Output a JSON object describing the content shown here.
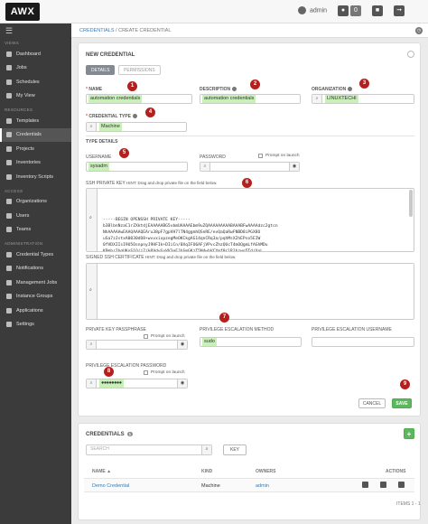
{
  "app": {
    "logo": "AWX"
  },
  "topbar": {
    "user": "admin",
    "notif_icon": "bell-icon",
    "badge_count": "0"
  },
  "sidebar": {
    "menu_icon": "☰",
    "sections": {
      "views": "VIEWS",
      "resources": "RESOURCES",
      "access": "ACCESS",
      "administration": "ADMINISTRATION"
    },
    "views": [
      "Dashboard",
      "Jobs",
      "Schedules",
      "My View"
    ],
    "resources": [
      "Templates",
      "Credentials",
      "Projects",
      "Inventories",
      "Inventory Scripts"
    ],
    "access": [
      "Organizations",
      "Users",
      "Teams"
    ],
    "administration": [
      "Credential Types",
      "Notifications",
      "Management Jobs",
      "Instance Groups",
      "Applications",
      "Settings"
    ]
  },
  "breadcrumb": {
    "link": "CREDENTIALS",
    "sep": " / ",
    "current": "CREATE CREDENTIAL"
  },
  "form": {
    "title": "NEW CREDENTIAL",
    "tabs": {
      "details": "DETAILS",
      "permissions": "PERMISSIONS"
    },
    "name": {
      "label": "NAME",
      "value": "automation credentials"
    },
    "description": {
      "label": "DESCRIPTION",
      "value": "automation credentials"
    },
    "organization": {
      "label": "ORGANIZATION",
      "value": "LINUXTECHI"
    },
    "credential_type": {
      "label": "CREDENTIAL TYPE",
      "value": "Machine"
    },
    "type_details": "TYPE DETAILS",
    "username": {
      "label": "USERNAME",
      "value": "sysadm"
    },
    "password": {
      "label": "PASSWORD",
      "prompt": "Prompt on launch"
    },
    "ssh_key": {
      "label": "SSH PRIVATE KEY",
      "hint": "HINT: Drag and drop private file on the field below.",
      "lines": [
        "-----BEGIN OPENSSH PRIVATE KEY-----",
        "b3BlbnNzaC1rZXktdjEAAAAABG5vbmUAAAAEbm9uZQAAAAAAAAABAAABFwAAAAdzc2gtcn",
        "NhAAAAAwEAAQAAAQEAru38pF7gpVH7lTN4ggmhQSnRE/evQaQaRwFNBD8iPGX8O",
        "uSa7zJstxA0030dO8+wvvxixpzegMeOKCkgAG14qnCRq3a/pqhMsX2hEPso5EIW",
        "0fVDXIIsI9U5OsnpnyJ9HFIk+DIiCn/0XqIFO6AFjVPvcZhzQUcT4mOQgmLfAGhMDu",
        "KPmbrIbgUKoS1Q/j7/k0VdvGyVV3eEJhSmGKzT5N4whVCYmf9rlR1bzwo5Td/XnL",
        "5yFlZdbZ3hIQaH3pRBi0WldSn2CEdQJDnmIzTbPHHd0E+p/mTmAFWhiD0mNRmzNvbH",
        "FFKBnuXkQfyg8SLoqqIs5rVCsJ0VNRVwwYFSe3tjRHK1mW2IEuRlFt9+UWLGTR4b"
      ]
    },
    "signed_cert": {
      "label": "SIGNED SSH CERTIFICATE",
      "hint": "HINT: Drag and drop private file on the field below."
    },
    "key_passphrase": {
      "label": "PRIVATE KEY PASSPHRASE",
      "prompt": "Prompt on launch"
    },
    "escalation_method": {
      "label": "PRIVILEGE ESCALATION METHOD",
      "value": "sudo"
    },
    "escalation_username": {
      "label": "PRIVILEGE ESCALATION USERNAME"
    },
    "escalation_password": {
      "label": "PRIVILEGE ESCALATION PASSWORD",
      "value": "●●●●●●●●",
      "prompt": "Prompt on launch"
    },
    "buttons": {
      "cancel": "CANCEL",
      "save": "SAVE"
    },
    "callouts": [
      "1",
      "2",
      "3",
      "4",
      "5",
      "6",
      "7",
      "8",
      "9"
    ]
  },
  "list": {
    "title": "CREDENTIALS",
    "count": "1",
    "search_placeholder": "SEARCH",
    "key_button": "KEY",
    "columns": {
      "name": "NAME ▲",
      "kind": "KIND",
      "owners": "OWNERS",
      "actions": "ACTIONS"
    },
    "rows": [
      {
        "name": "Demo Credential",
        "kind": "Machine",
        "owners": "admin"
      }
    ],
    "pager": "ITEMS 1 - 1"
  },
  "colors": {
    "sidebar_bg": "#3b3b3b",
    "callout": "#b3201e",
    "save_green": "#5cb85c",
    "highlight_green": "#c8f0b8",
    "link_blue": "#337ab7"
  }
}
